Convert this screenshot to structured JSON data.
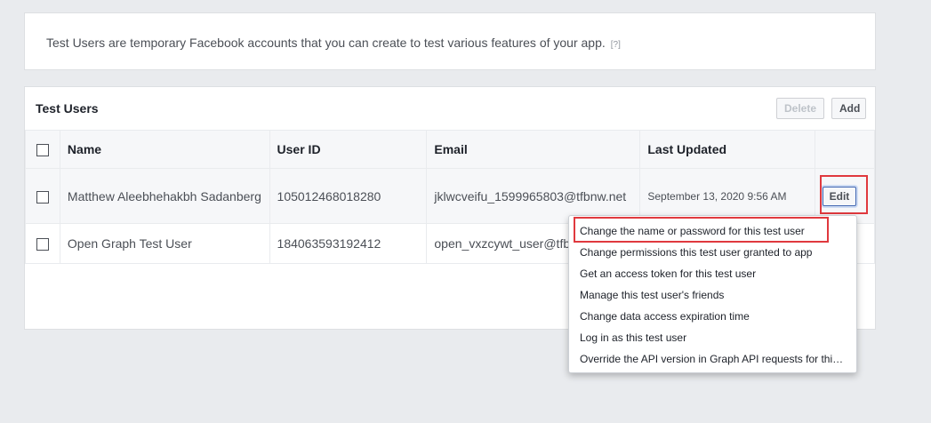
{
  "info": {
    "text": "Test Users are temporary Facebook accounts that you can create to test various features of your app.",
    "help": "[?]"
  },
  "panel": {
    "title": "Test Users",
    "delete_label": "Delete",
    "add_label": "Add"
  },
  "table": {
    "headers": [
      "Name",
      "User ID",
      "Email",
      "Last Updated"
    ],
    "rows": [
      {
        "name": "Matthew Aleebhehakbh Sadanberg",
        "user_id": "105012468018280",
        "email": "jklwcveifu_1599965803@tfbnw.net",
        "updated": "September 13, 2020 9:56 AM",
        "action": "Edit"
      },
      {
        "name": "Open Graph Test User",
        "user_id": "184063593192412",
        "email": "open_vxzcywt_user@tfb",
        "updated": "",
        "action": ""
      }
    ]
  },
  "menu": {
    "items": [
      "Change the name or password for this test user",
      "Change permissions this test user granted to app",
      "Get an access token for this test user",
      "Manage this test user's friends",
      "Change data access expiration time",
      "Log in as this test user",
      "Override the API version in Graph API requests for this ..."
    ]
  },
  "colors": {
    "highlight": "#e0393e",
    "background": "#e9ebee",
    "accent": "#4267b2"
  }
}
